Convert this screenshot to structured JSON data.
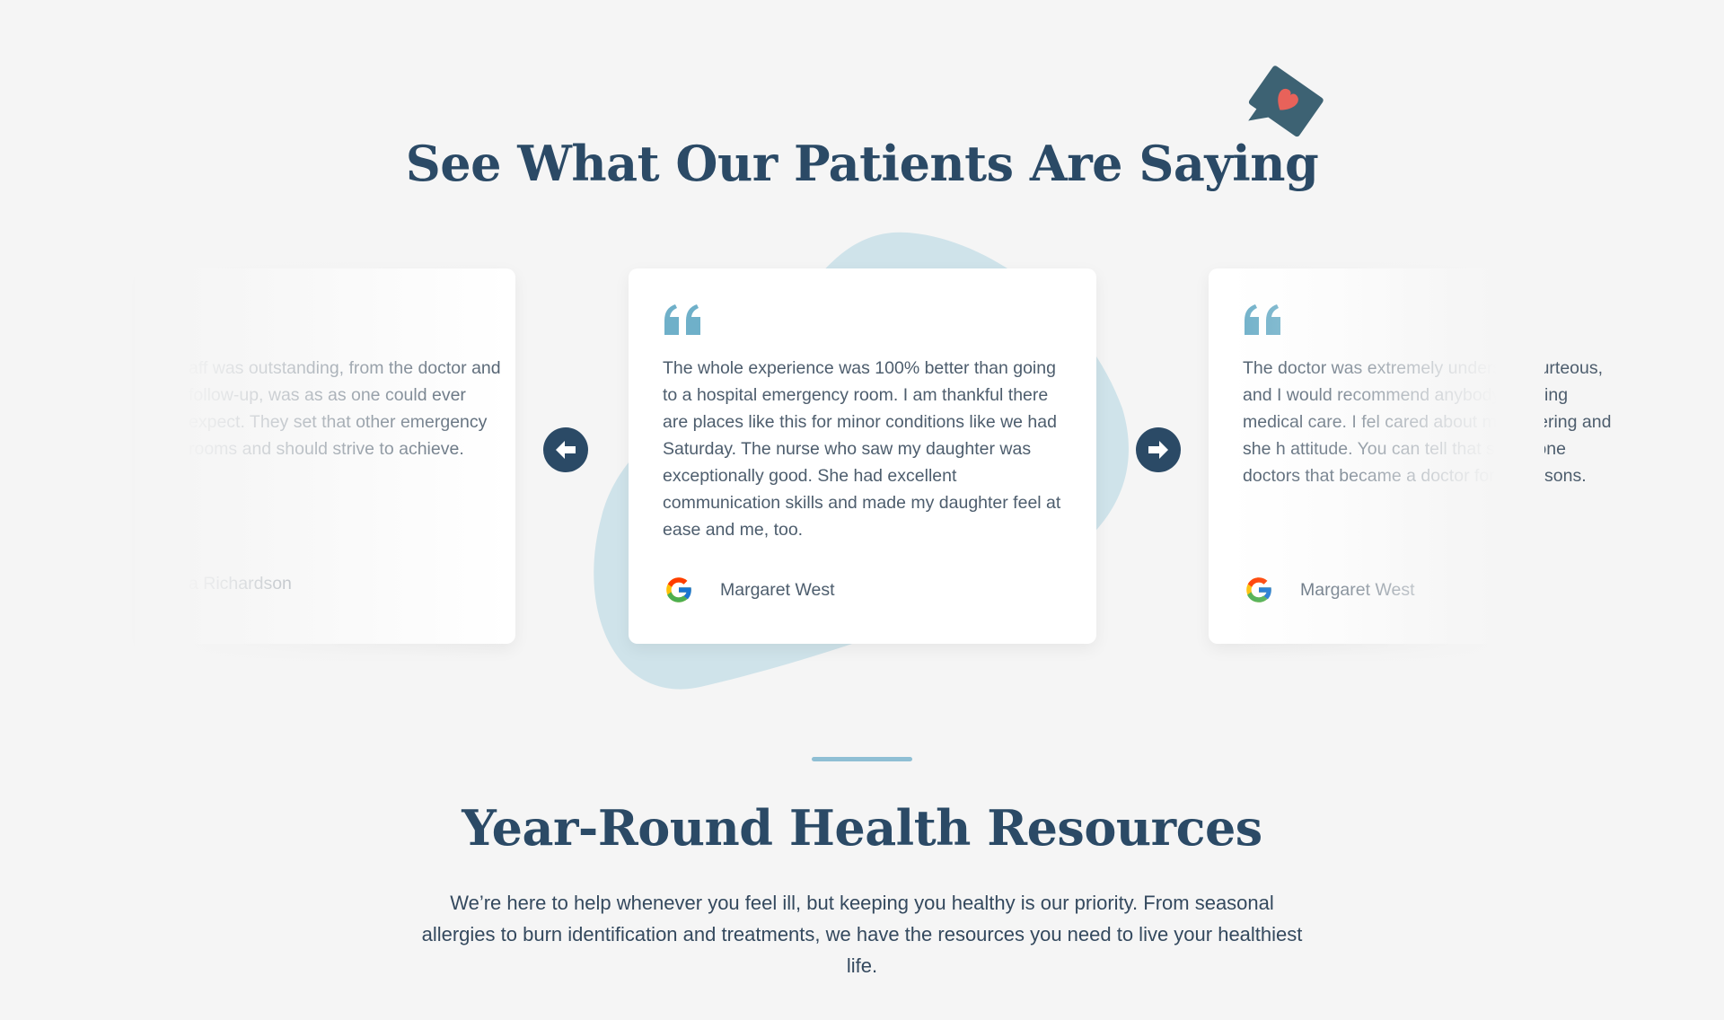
{
  "testimonials_section": {
    "title": "See What Our Patients Are Saying",
    "icon": "heart-chat-icon",
    "prev_label": "arrow-left-icon",
    "next_label": "arrow-right-icon"
  },
  "testimonials": [
    {
      "text": "aff was outstanding, from the doctor and follow-up, was as as one could ever expect. They set that other emergency rooms and should strive to achieve.",
      "author": "a Richardson",
      "source_icon": "google-icon"
    },
    {
      "text": "The whole experience was 100% better than going to a hospital emergency room. I am thankful there are places like this for minor conditions like we had Saturday. The nurse who saw my daughter was exceptionally good. She had excellent communication skills and made my daughter feel at ease and me, too.",
      "author": "Margaret West",
      "source_icon": "google-icon"
    },
    {
      "text": "The doctor was extremely understa courteous, and I would recommend anybody needing medical care. I fel cared about my suffering and she h attitude. You can tell that she is one doctors that became a doctor for th reasons.",
      "author": "Margaret West",
      "source_icon": "google-icon"
    }
  ],
  "resources_section": {
    "title": "Year-Round Health Resources",
    "description": "We’re here to help whenever you feel ill, but keeping you healthy is our priority. From seasonal allergies to burn identification and treatments, we have the resources you need to live your healthiest life."
  },
  "colors": {
    "heading": "#2b4a66",
    "accent_blue": "#6fb0c9",
    "blob": "#cfe3ea",
    "heart": "#e8625a",
    "background": "#f5f5f5"
  }
}
